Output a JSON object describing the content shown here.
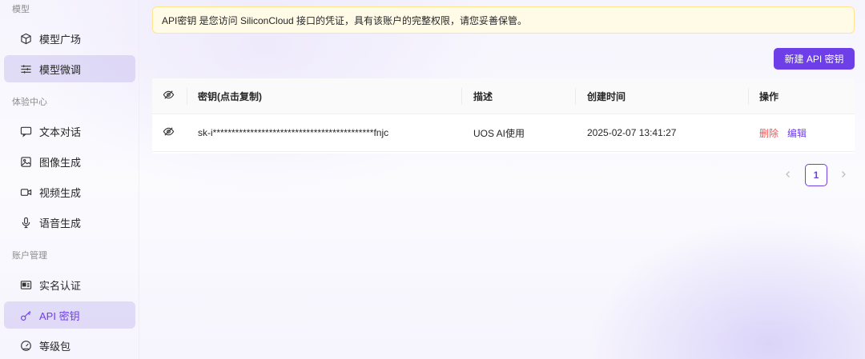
{
  "sidebar": {
    "groups": [
      {
        "label": "模型"
      },
      {
        "label": "体验中心"
      },
      {
        "label": "账户管理"
      }
    ],
    "items": [
      {
        "label": "模型广场",
        "icon": "cube-icon"
      },
      {
        "label": "模型微调",
        "icon": "sliders-icon",
        "active": true
      },
      {
        "label": "文本对话",
        "icon": "chat-icon"
      },
      {
        "label": "图像生成",
        "icon": "image-icon"
      },
      {
        "label": "视频生成",
        "icon": "video-icon"
      },
      {
        "label": "语音生成",
        "icon": "microphone-icon"
      },
      {
        "label": "实名认证",
        "icon": "id-card-icon"
      },
      {
        "label": "API 密钥",
        "icon": "key-icon",
        "active": true,
        "selected": true
      },
      {
        "label": "等级包",
        "icon": "gauge-icon"
      }
    ]
  },
  "notice": {
    "text": "API密钥 是您访问 SiliconCloud 接口的凭证，具有该账户的完整权限，请您妥善保管。"
  },
  "toolbar": {
    "new_key_label": "新建 API 密钥"
  },
  "table": {
    "headers": {
      "key": "密钥(点击复制)",
      "description": "描述",
      "created": "创建时间",
      "actions": "操作"
    },
    "rows": [
      {
        "key": "sk-i*******************************************fnjc",
        "description": "UOS AI使用",
        "created": "2025-02-07 13:41:27",
        "delete_label": "删除",
        "edit_label": "编辑"
      }
    ]
  },
  "pagination": {
    "current_page": "1"
  },
  "colors": {
    "accent": "#6e3ee8",
    "danger": "#ff4d4f",
    "notice_bg": "#fffbe6",
    "notice_border": "#ffe58f"
  }
}
